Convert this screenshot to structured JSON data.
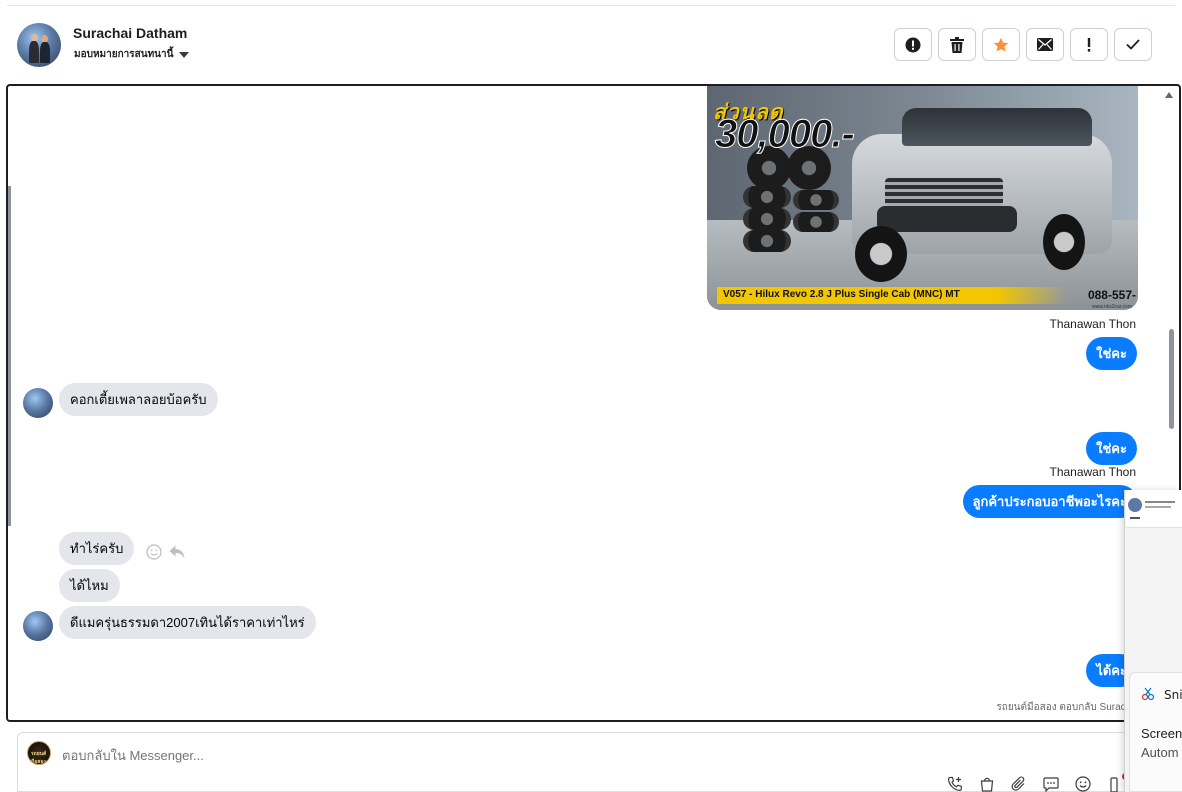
{
  "header": {
    "contact_name": "Surachai Datham",
    "assign_label": "มอบหมายการสนทนานี้",
    "toolbar": [
      {
        "icon": "alert-circle-icon"
      },
      {
        "icon": "trash-icon"
      },
      {
        "icon": "star-icon",
        "color": "#f7923a"
      },
      {
        "icon": "mail-icon"
      },
      {
        "icon": "exclamation-icon"
      },
      {
        "icon": "check-icon"
      }
    ]
  },
  "car_image": {
    "promo_text": "ส่วนลด",
    "promo_amount": "30,000.-",
    "caption": "V057 - Hilux Revo 2.8 J Plus Single Cab (MNC) MT",
    "phone": "088-557-",
    "site": "www.nks2car.com"
  },
  "messages": {
    "sender_1": "Thanawan Thon",
    "out_1": "ใช่คะ",
    "in_1": "คอกเตี้ยเพลาลอยบ้อครับ",
    "out_2": "ใช่คะ",
    "sender_2": "Thanawan Thon",
    "out_3": "ลูกค้าประกอบอาชีพอะไรคะ",
    "in_2": "ทำไร่ครับ",
    "in_3": "ได้ไหม",
    "in_4": "ดีแมครุ่นธรรมดา2007เทินได้ราคาเท่าไหร่",
    "out_4": "ได้คะ"
  },
  "footer_note": "รถยนต์มือสอง ตอบกลับ Surachai",
  "reply": {
    "page_avatar_text": "รถยนต์มือสอง",
    "placeholder": "ตอบกลับใน Messenger..."
  },
  "snip_overlay": {
    "app_title": "Sni",
    "heading": "Screen",
    "subtext": "Autom"
  },
  "colors": {
    "outgoing_bubble": "#0a7cff",
    "incoming_bubble": "#e4e6eb",
    "star_accent": "#f7923a"
  }
}
